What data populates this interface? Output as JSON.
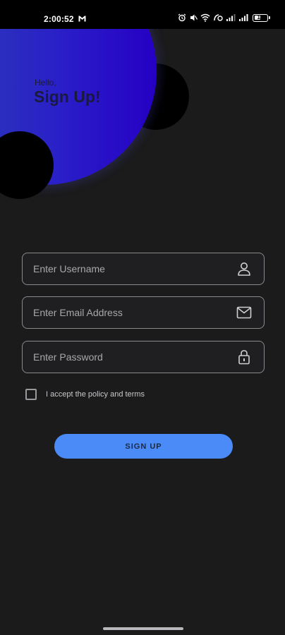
{
  "status_bar": {
    "time": "2:00:52",
    "battery_level": "18"
  },
  "header": {
    "greeting": "Hello,",
    "title": "Sign Up!"
  },
  "form": {
    "username": {
      "placeholder": "Enter Username",
      "value": ""
    },
    "email": {
      "placeholder": "Enter Email Address",
      "value": ""
    },
    "password": {
      "placeholder": "Enter Password",
      "value": ""
    },
    "terms_label": "I accept the policy and terms",
    "terms_checked": false,
    "submit_label": "SIGN UP"
  },
  "icons": {
    "username": "user-icon",
    "email": "mail-icon",
    "password": "lock-icon"
  },
  "colors": {
    "background": "#1b1b1c",
    "accent_button": "#4a8bf7",
    "circle_gradient_start": "#2b3fb2",
    "circle_gradient_end": "#2600c4"
  }
}
